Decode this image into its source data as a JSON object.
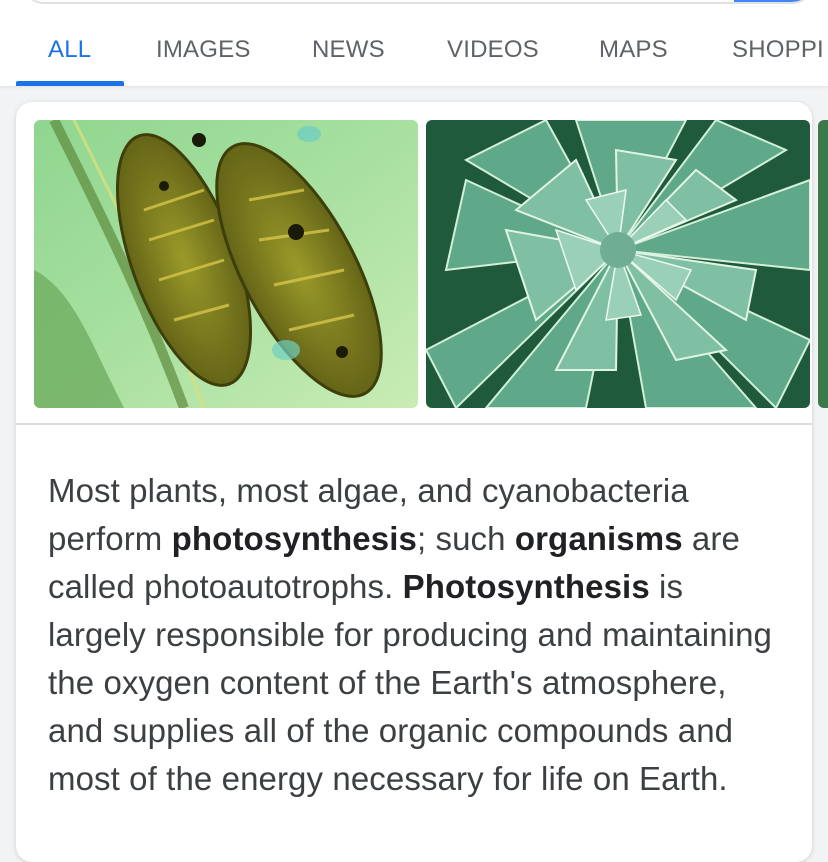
{
  "tabs": [
    {
      "label": "ALL",
      "active": true
    },
    {
      "label": "IMAGES",
      "active": false
    },
    {
      "label": "NEWS",
      "active": false
    },
    {
      "label": "VIDEOS",
      "active": false
    },
    {
      "label": "MAPS",
      "active": false
    },
    {
      "label": "SHOPPI",
      "active": false
    }
  ],
  "images": [
    {
      "subject": "chloroplast micrograph"
    },
    {
      "subject": "succulent rosette"
    }
  ],
  "snippet": {
    "t1": "Most plants, most algae, and cyanobacteria perform ",
    "b1": "photosynthesis",
    "t2": "; such ",
    "b2": "organisms",
    "t3": " are called photoautotrophs. ",
    "b3": "Photosynthesis",
    "t4": " is largely responsible for producing and maintaining the oxygen content of the Earth's atmosphere, and supplies all of the organic compounds and most of the energy necessary for life on Earth."
  },
  "colors": {
    "accent": "#1a73e8",
    "search_button": "#4285f4"
  }
}
